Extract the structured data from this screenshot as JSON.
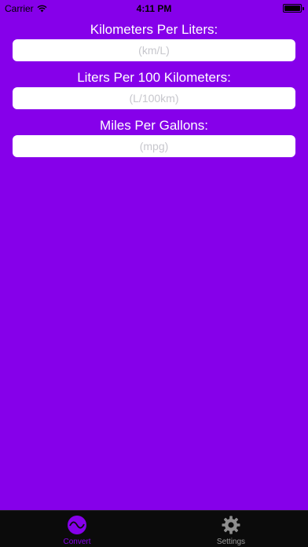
{
  "status_bar": {
    "carrier": "Carrier",
    "time": "4:11 PM"
  },
  "fields": [
    {
      "label": "Kilometers Per Liters:",
      "placeholder": "(km/L)",
      "value": ""
    },
    {
      "label": "Liters Per 100 Kilometers:",
      "placeholder": "(L/100km)",
      "value": ""
    },
    {
      "label": "Miles Per Gallons:",
      "placeholder": "(mpg)",
      "value": ""
    }
  ],
  "tab_bar": {
    "tabs": [
      {
        "label": "Convert",
        "icon": "wave-circle-icon",
        "selected": true
      },
      {
        "label": "Settings",
        "icon": "gear-icon",
        "selected": false
      }
    ]
  },
  "colors": {
    "background": "#8600ea",
    "accent": "#8600ea",
    "tab_bar": "#0b0b0b"
  }
}
